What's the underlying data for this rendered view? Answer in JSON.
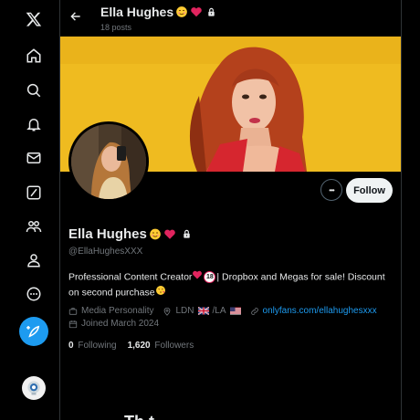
{
  "nav": {
    "items": [
      {
        "icon": "x-logo-icon"
      },
      {
        "icon": "home-icon"
      },
      {
        "icon": "search-icon"
      },
      {
        "icon": "bell-icon"
      },
      {
        "icon": "mail-icon"
      },
      {
        "icon": "grok-icon"
      },
      {
        "icon": "communities-icon"
      },
      {
        "icon": "profile-icon"
      },
      {
        "icon": "more-circle-icon"
      }
    ],
    "post_icon": "feather-plus-icon",
    "account_avatar": "account-avatar"
  },
  "header": {
    "name": "Ella Hughes",
    "post_count": "18 posts"
  },
  "profile": {
    "display_name": "Ella Hughes",
    "handle": "@EllaHughesXXX",
    "bio_part1": "Professional Content Creator",
    "bio_part2": "| Dropbox and Megas for sale! Discount on second purchase",
    "category": "Media Personality",
    "location_a": "LDN",
    "location_b": "/LA",
    "website": "onlyfans.com/ellahughesxxx",
    "joined": "Joined March 2024",
    "following_count": "0",
    "following_label": "Following",
    "followers_count": "1,620",
    "followers_label": "Followers",
    "more_label": "•••",
    "follow_label": "Follow",
    "age_badge": "18"
  },
  "partial_bottom_text": "Th          t",
  "colors": {
    "accent": "#1d9bf0",
    "banner": "#f0bd22",
    "heart": "#e0245e"
  }
}
